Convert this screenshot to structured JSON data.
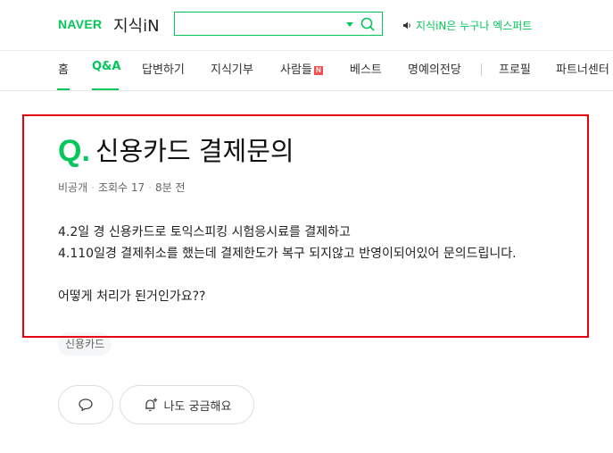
{
  "header": {
    "brand": "NAVER",
    "service": "지식iN",
    "search": {
      "value": "",
      "placeholder": ""
    },
    "notice": "지식iN은 누구나 엑스퍼트",
    "icons": [
      "chevron-down-icon",
      "search-icon",
      "speaker-icon"
    ]
  },
  "nav": {
    "items": [
      {
        "label": "홈"
      },
      {
        "label": "Q&A"
      },
      {
        "label": "답변하기"
      },
      {
        "label": "지식기부"
      },
      {
        "label": "사람들",
        "badge": "N"
      },
      {
        "label": "베스트"
      },
      {
        "label": "명예의전당"
      },
      {
        "label": "프로필"
      },
      {
        "label": "파트너센터"
      }
    ],
    "active": "Q&A"
  },
  "question": {
    "q_mark": "Q",
    "title": "신용카드 결제문의",
    "meta": {
      "author": "비공개",
      "views": "조회수 17",
      "time": "8분 전"
    },
    "body": [
      "4.2일 경 신용카드로 토익스피킹 시험응시료를 결제하고",
      "4.110일경 결제취소를 했는데 결제한도가 복구 되지않고 반영이되어있어 문의드립니다.",
      "",
      "어떻게 처리가 된거인가요??"
    ],
    "tag": "신용카드"
  },
  "actions": {
    "curious_label": "나도 궁금해요",
    "icons": [
      "comment-icon",
      "bell-plus-icon"
    ]
  },
  "colors": {
    "brand": "#03c75a",
    "highlight": "#e60012"
  }
}
